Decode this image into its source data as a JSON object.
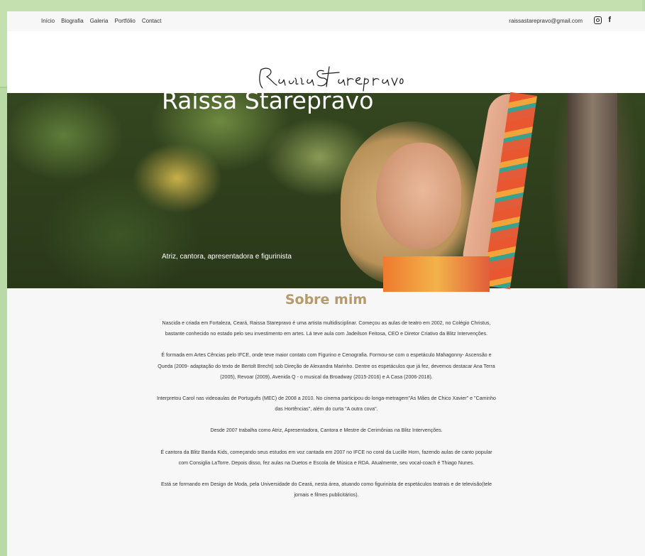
{
  "nav": {
    "items": [
      "Início",
      "Biografia",
      "Galeria",
      "Portfólio",
      "Contact"
    ]
  },
  "contact": {
    "email": "raissastarepravo@gmail.com"
  },
  "social": {
    "icons": [
      "instagram-icon",
      "facebook-icon"
    ],
    "facebook_glyph": "f"
  },
  "logo": {
    "text": "Raissa Starepravo"
  },
  "hero": {
    "title": "Raissa Starepravo",
    "subtitle": "Atriz, cantora, apresentadora e figurinista"
  },
  "about": {
    "title": "Sobre mim",
    "paragraphs": [
      "Nascida e criada em Fortaleza, Ceará, Raissa Starepravo é uma artista multidisciplinar. Começou as aulas de teatro em 2002, no Colégio Christus, bastante conhecido no estado pelo seu investimento em artes. Lá teve aula com Jadeilson Feitosa, CEO e Diretor Criativo da Blitz Intervenções.",
      "É formada em Artes Cências pelo IFCE, onde teve maior contato com Figurino e Cenografia. Formou-se com o espetáculo Mahagonny- Ascensão e Queda (2009- adaptação do texto de Bertolt Brecht) sob Direção de Alexandra Marinho.  Dentre os espetáculos que já fez, devemos destacar Ana Terra (2005), Revoar (2009), Avenida Q - o musical da Broadway (2015-2016) e A Casa (2006-2018).",
      "Interpretou Carol nas videoaulas de Português (MEC) de 2008 a 2010. No cinema participou do longa-metragem\"As Mães de Chico Xavier\" e \"Caminho das Hortências\", além do curta \"A outra cova\".",
      "Desde 2007 trabalha como Atriz, Apresentadora, Cantora e Mestre de Cerimônias na Blitz Intervenções.",
      "É cantora da Blitz Banda Kids, começando seus estudos em voz cantada em 2007 no IFCE no coral da Lucille Horn, fazendo aulas de canto popular com Consiglia LaTorre. Depois disso, fez aulas na Duetos e Escola de Música e RDA. Atualmente, seu vocal-coach é Thiago Nunes.",
      "Está se formando em Design de Moda, pela Universidade do Ceará, nesta área, atuando como figurinista de espetáculos teatrais e de televisão(tele jornais e filmes publicitários)."
    ]
  }
}
